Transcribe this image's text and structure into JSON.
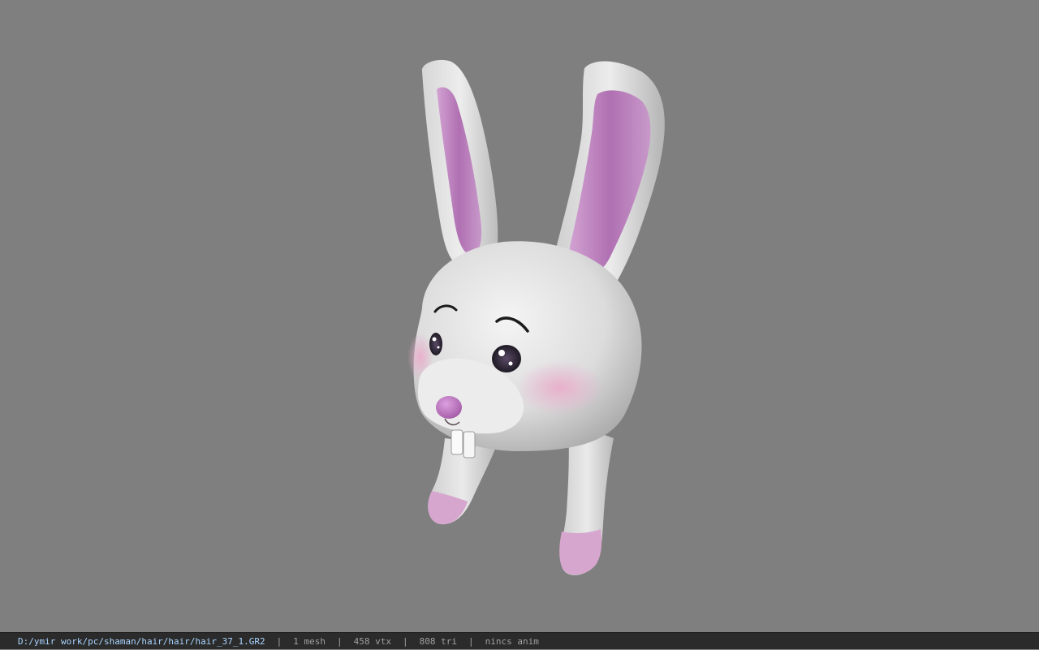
{
  "viewer": {
    "background_color": "#7f7f7f",
    "model_name": "rabbit-hair-model"
  },
  "status_bar": {
    "file_path": "D:/ymir work/pc/shaman/hair/hair/hair_37_1.GR2",
    "separator": "|",
    "mesh_count": "1 mesh",
    "vertex_count": "458 vtx",
    "triangle_count": "808 tri",
    "anim_status": "nincs anim"
  },
  "colors": {
    "fur": "#e4e4e4",
    "fur_shadow": "#a9a9a9",
    "ear_inner": "#b878b8",
    "blush": "#e8b4cf",
    "nose": "#c07ac4",
    "status_path": "#a8d4ff",
    "status_text": "#a0a0a0"
  }
}
